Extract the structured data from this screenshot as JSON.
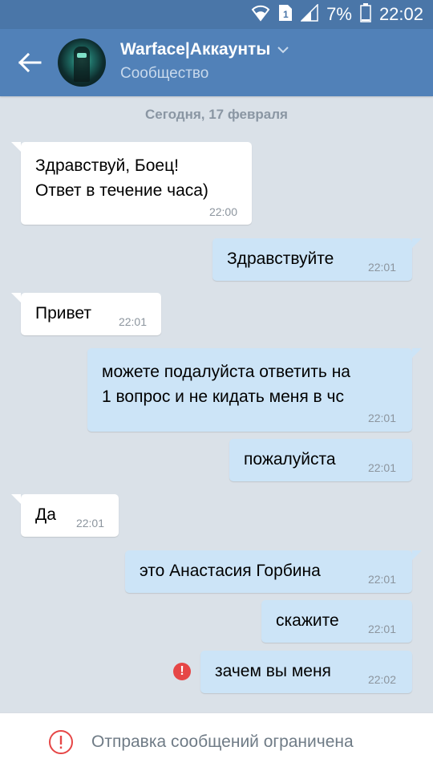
{
  "status_bar": {
    "battery": "7%",
    "time": "22:02"
  },
  "header": {
    "title": "Warface|Аккаунты",
    "subtitle": "Сообщество"
  },
  "date_separator": "Сегодня, 17 февраля",
  "messages": [
    {
      "direction": "in",
      "lines": [
        "Здравствуй, Боец!",
        "Ответ в течение часа)"
      ],
      "time": "22:00"
    },
    {
      "direction": "out",
      "lines": [
        "Здравствуйте"
      ],
      "time": "22:01"
    },
    {
      "direction": "in",
      "lines": [
        "Привет"
      ],
      "time": "22:01"
    },
    {
      "direction": "out",
      "lines": [
        "можете подалуйста ответить на",
        "1 вопрос и не кидать меня в чс"
      ],
      "time": "22:01"
    },
    {
      "direction": "out",
      "lines": [
        "пожалуйста"
      ],
      "time": "22:01"
    },
    {
      "direction": "in",
      "lines": [
        "Да"
      ],
      "time": "22:01"
    },
    {
      "direction": "out",
      "lines": [
        "это Анастасия Горбина"
      ],
      "time": "22:01"
    },
    {
      "direction": "out",
      "lines": [
        "скажите"
      ],
      "time": "22:01"
    },
    {
      "direction": "out",
      "lines": [
        "зачем вы меня"
      ],
      "time": "22:02",
      "failed": true
    }
  ],
  "bottom_notice": "Отправка сообщений ограничена",
  "icons": {
    "back": "arrow-left-icon",
    "dropdown": "chevron-down-icon",
    "error": "exclamation-circle-icon",
    "notice": "exclamation-circle-outline-icon"
  },
  "colors": {
    "header": "#5181b8",
    "statusbar": "#4a76a8",
    "background": "#dae1e8",
    "incoming": "#ffffff",
    "outgoing": "#cce4f7",
    "error": "#e64646"
  }
}
